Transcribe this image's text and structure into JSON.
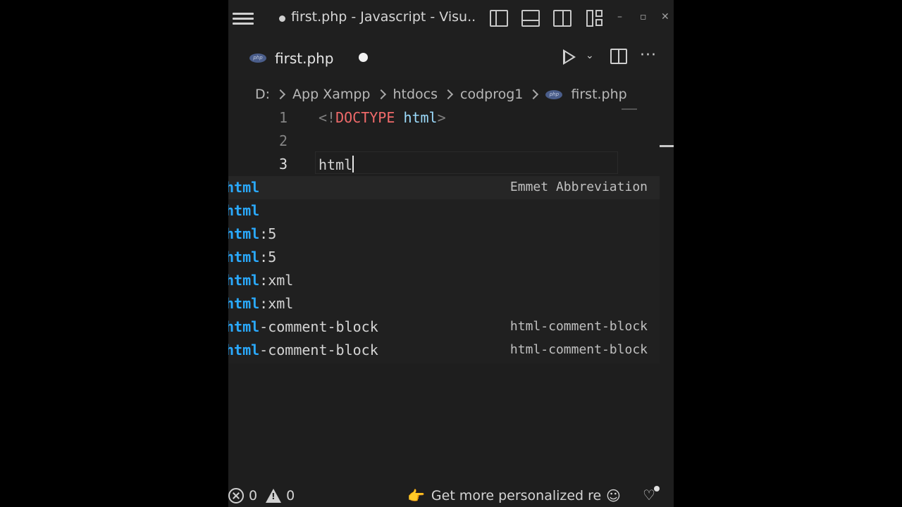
{
  "window": {
    "title": "first.php - Javascript - Visu...",
    "minimize": "–",
    "maximize": "▫",
    "close": "✕"
  },
  "tab": {
    "label": "first.php",
    "badge": "php",
    "modified": true
  },
  "toolbar": {
    "more": "···",
    "dropdown": "⌄"
  },
  "breadcrumb": {
    "items": [
      "D:",
      "App Xampp",
      "htdocs",
      "codprog1",
      "first.php"
    ],
    "file_badge": "php"
  },
  "editor": {
    "lines": [
      {
        "number": "1",
        "punct_open": "<!",
        "keyword": "DOCTYPE",
        "space": " ",
        "attr": "html",
        "punct_close": ">"
      },
      {
        "number": "2",
        "text": ""
      },
      {
        "number": "3",
        "text": "html"
      }
    ]
  },
  "suggestions": [
    {
      "match": "html",
      "rest": "",
      "detail": "Emmet Abbreviation"
    },
    {
      "match": "html",
      "rest": "",
      "detail": ""
    },
    {
      "match": "html",
      "rest": ":5",
      "detail": ""
    },
    {
      "match": "html",
      "rest": ":5",
      "detail": ""
    },
    {
      "match": "html",
      "rest": ":xml",
      "detail": ""
    },
    {
      "match": "html",
      "rest": ":xml",
      "detail": ""
    },
    {
      "match": "html",
      "rest": "-comment-block",
      "detail": "html-comment-block"
    },
    {
      "match": "html",
      "rest": "-comment-block",
      "detail": "html-comment-block"
    }
  ],
  "status": {
    "errors": "0",
    "warnings": "0",
    "promo": "Get more personalized re",
    "promo_icon": "👉"
  },
  "colors": {
    "match": "#2aaaff",
    "keyword": "#f06a6a",
    "attr": "#9cdcfe",
    "background": "#1e1e1e"
  }
}
